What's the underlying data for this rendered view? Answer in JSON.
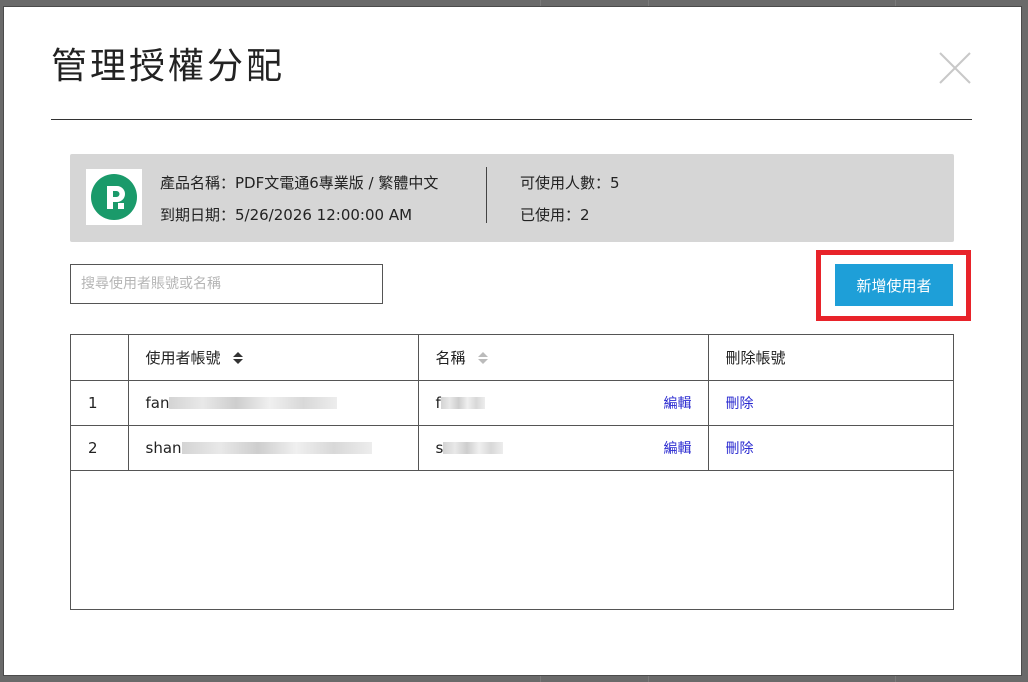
{
  "dialog": {
    "title": "管理授權分配"
  },
  "product": {
    "name_line": "產品名稱：PDF文電通6專業版 / 繁體中文",
    "expiry_line": "到期日期：5/26/2026 12:00:00 AM",
    "available_line": "可使用人數：5",
    "used_line": "已使用：2",
    "logo_color": "#1a9a6a"
  },
  "search": {
    "placeholder": "搜尋使用者賬號或名稱",
    "value": ""
  },
  "actions": {
    "add_user_label": "新增使用者",
    "add_user_color": "#1e9fd8",
    "highlight_color": "#e8232a"
  },
  "table": {
    "headers": {
      "index": "",
      "account": "使用者帳號",
      "name": "名稱",
      "delete": "刪除帳號"
    },
    "rows": [
      {
        "index": "1",
        "account": "fan",
        "name": "f",
        "edit": "編輯",
        "delete": "刪除"
      },
      {
        "index": "2",
        "account": "shan",
        "name": "s",
        "edit": "編輯",
        "delete": "刪除"
      }
    ]
  },
  "icons": {
    "close": "close-icon",
    "sort": "sort-icon",
    "logo": "pdf-app-logo"
  }
}
